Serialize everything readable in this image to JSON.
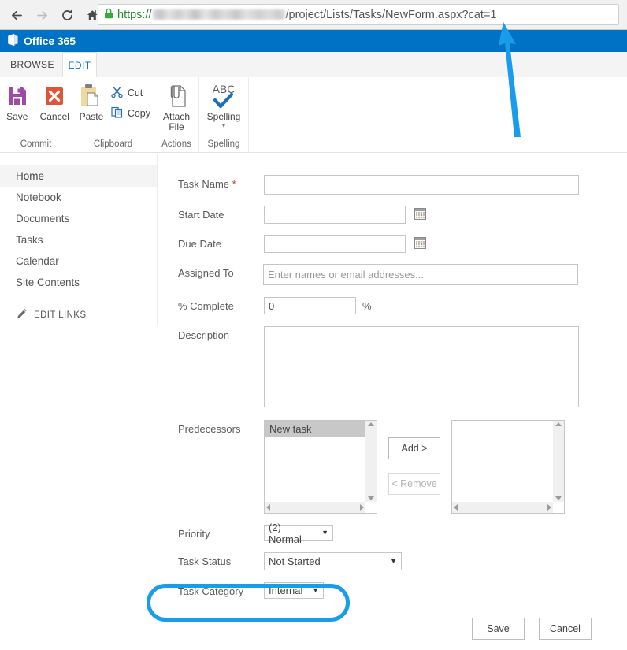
{
  "browser": {
    "back_icon": "back-arrow-icon",
    "forward_icon": "forward-arrow-icon",
    "reload_icon": "reload-icon",
    "home_icon": "home-icon",
    "lock_icon": "lock-icon",
    "url_scheme": "https://",
    "url_host_redacted": "redacted-domain",
    "url_path": "/project/Lists/Tasks/NewForm.aspx?cat=1"
  },
  "suite": {
    "logo_icon": "office-tile-icon",
    "brand": "Office 365"
  },
  "ribbon": {
    "tabs": [
      {
        "label": "BROWSE",
        "active": false
      },
      {
        "label": "EDIT",
        "active": true
      }
    ],
    "groups": [
      {
        "name": "commit",
        "label": "Commit",
        "items": [
          {
            "name": "save",
            "label": "Save",
            "icon": "floppy-disk-icon"
          },
          {
            "name": "cancel",
            "label": "Cancel",
            "icon": "red-x-icon"
          }
        ]
      },
      {
        "name": "clipboard",
        "label": "Clipboard",
        "items": [
          {
            "name": "paste",
            "label": "Paste",
            "icon": "clipboard-icon"
          },
          {
            "name": "cut",
            "label": "Cut",
            "icon": "scissors-icon"
          },
          {
            "name": "copy",
            "label": "Copy",
            "icon": "copy-pages-icon"
          }
        ]
      },
      {
        "name": "actions",
        "label": "Actions",
        "items": [
          {
            "name": "attach-file",
            "label_line1": "Attach",
            "label_line2": "File",
            "icon": "paperclip-document-icon"
          }
        ]
      },
      {
        "name": "spelling",
        "label": "Spelling",
        "items": [
          {
            "name": "spelling",
            "label": "Spelling",
            "icon": "abc-checkmark-icon",
            "dropdown": "▾"
          }
        ]
      }
    ]
  },
  "quicklaunch": {
    "items": [
      {
        "label": "Home",
        "selected": true
      },
      {
        "label": "Notebook",
        "selected": false
      },
      {
        "label": "Documents",
        "selected": false
      },
      {
        "label": "Tasks",
        "selected": false
      },
      {
        "label": "Calendar",
        "selected": false
      },
      {
        "label": "Site Contents",
        "selected": false
      }
    ],
    "edit_links": {
      "label": "EDIT LINKS",
      "icon": "pencil-icon"
    }
  },
  "form": {
    "task_name": {
      "label": "Task Name",
      "required_marker": "*",
      "value": ""
    },
    "start_date": {
      "label": "Start Date",
      "value": "",
      "picker_icon": "calendar-icon"
    },
    "due_date": {
      "label": "Due Date",
      "value": "",
      "picker_icon": "calendar-icon"
    },
    "assigned_to": {
      "label": "Assigned To",
      "value": "",
      "placeholder": "Enter names or email addresses..."
    },
    "percent_complete": {
      "label": "% Complete",
      "value": "0",
      "suffix": "%"
    },
    "description": {
      "label": "Description",
      "value": ""
    },
    "predecessors": {
      "label": "Predecessors",
      "available": [
        {
          "label": "New task",
          "selected": true
        }
      ],
      "chosen": [],
      "add_button": "Add >",
      "remove_button": "< Remove",
      "remove_disabled": true,
      "scroll_up_icon": "scroll-up-arrow-icon",
      "scroll_down_icon": "scroll-down-arrow-icon",
      "scroll_left_icon": "scroll-left-arrow-icon",
      "scroll_right_icon": "scroll-right-arrow-icon"
    },
    "priority": {
      "label": "Priority",
      "value": "(2) Normal",
      "caret": "▼"
    },
    "task_status": {
      "label": "Task Status",
      "value": "Not Started",
      "caret": "▼"
    },
    "task_category": {
      "label": "Task Category",
      "value": "Internal",
      "caret": "▼"
    },
    "actions": {
      "save": "Save",
      "cancel": "Cancel"
    }
  },
  "annotations": {
    "highlight_color": "#1a9cec",
    "arrow_color": "#1a9cec",
    "oval_target": "task-category-row",
    "arrow_target": "url-query-parameter"
  }
}
